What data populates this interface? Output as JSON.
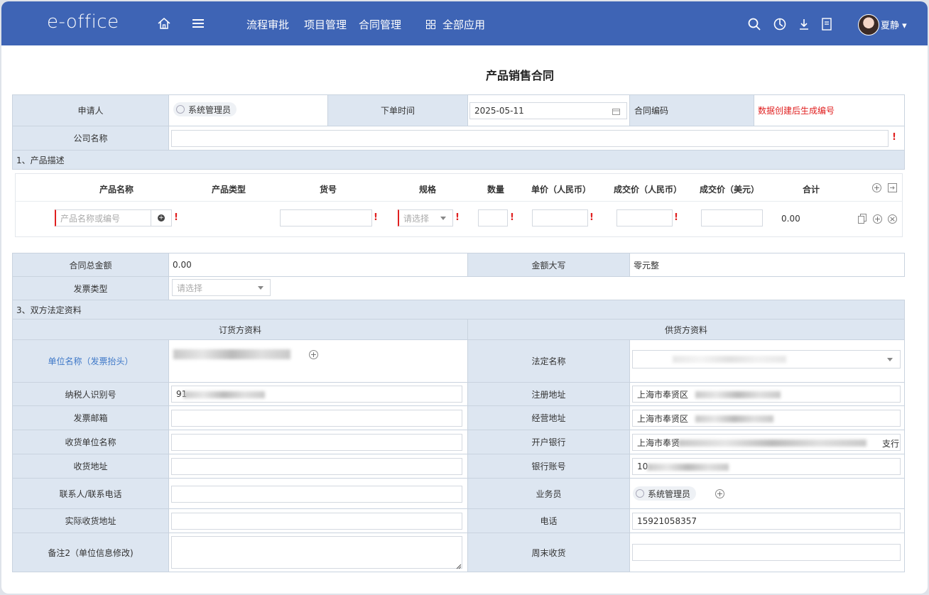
{
  "app": {
    "logo": "e-office",
    "user": "夏静"
  },
  "nav": {
    "items": [
      "流程审批",
      "项目管理",
      "合同管理",
      "全部应用"
    ]
  },
  "form": {
    "title": "产品销售合同",
    "applicant_label": "申请人",
    "applicant": "系统管理员",
    "order_time_label": "下单时间",
    "order_time": "2025-05-11",
    "contract_no_label": "合同编码",
    "contract_no": "数据创建后生成编号",
    "company_label": "公司名称",
    "section1": "1、产品描述",
    "product_headers": [
      "产品名称",
      "产品类型",
      "货号",
      "规格",
      "数量",
      "单价（人民币）",
      "成交价（人民币）",
      "成交价（美元）",
      "合计"
    ],
    "product_placeholder": "产品名称或编号",
    "spec_placeholder": "请选择",
    "row_total": "0.00",
    "total_label": "合同总金额",
    "total": "0.00",
    "capital_label": "金额大写",
    "capital": "零元整",
    "invoice_type_label": "发票类型",
    "invoice_type_placeholder": "请选择",
    "section3": "3、双方法定资料",
    "buyer_title": "订货方资料",
    "supplier_title": "供货方资料",
    "left_labels": [
      "单位名称（发票抬头）",
      "纳税人识别号",
      "发票邮箱",
      "收货单位名称",
      "收货地址",
      "联系人/联系电话",
      "实际收货地址",
      "备注2（单位信息修改)"
    ],
    "tax_id_prefix": "91",
    "right_labels": [
      "法定名称",
      "注册地址",
      "经营地址",
      "开户银行",
      "银行账号",
      "业务员",
      "电话",
      "周末收货"
    ],
    "reg_addr": "上海市奉贤区",
    "op_addr": "上海市奉贤区",
    "bank": "上海市奉贤",
    "bank_suffix": "支行",
    "account_prefix": "10",
    "salesman": "系统管理员",
    "phone": "15921058357"
  },
  "colors": {
    "topbar": "#3e64b5",
    "label_bg": "#dde6f1",
    "required": "#e02020",
    "link": "#3e78c8"
  }
}
